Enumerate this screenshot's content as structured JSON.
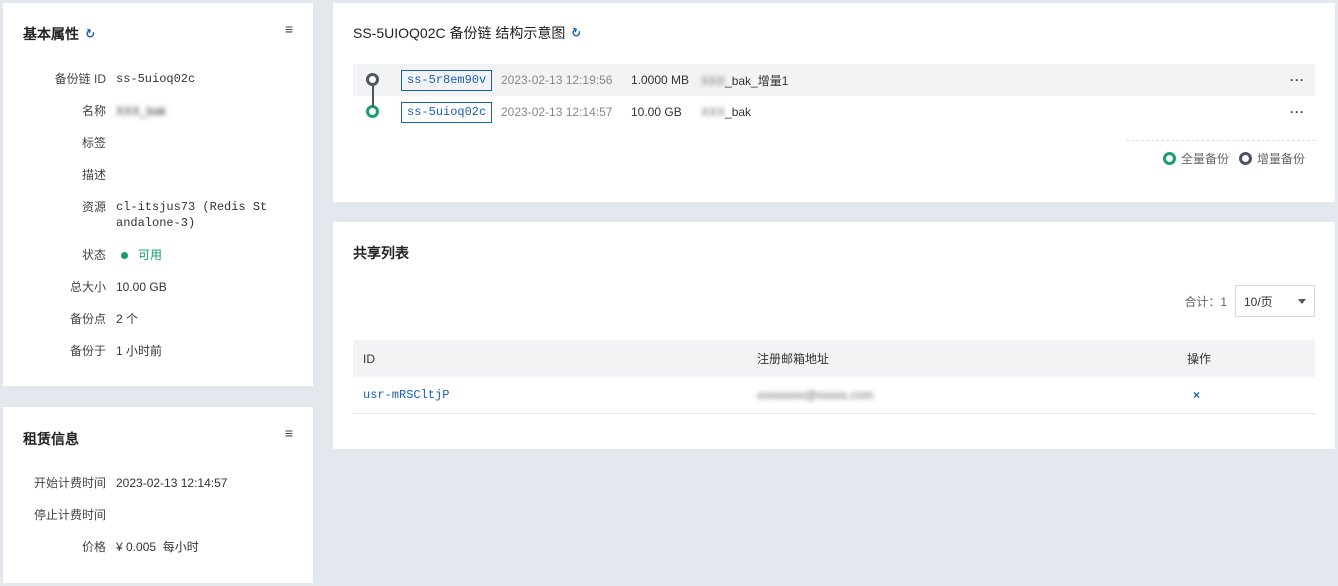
{
  "basic": {
    "title": "基本属性",
    "fields": [
      {
        "key": "备份链 ID",
        "value": "ss-5uioq02c"
      },
      {
        "key": "名称",
        "value": "XXX_bak"
      },
      {
        "key": "标签",
        "value": ""
      },
      {
        "key": "描述",
        "value": ""
      },
      {
        "key": "资源",
        "value_line1": "cl-itsjus73 (Redis St",
        "value_line2": "andalone-3)"
      },
      {
        "key": "状态",
        "value": "可用"
      },
      {
        "key": "总大小",
        "value": "10.00 GB"
      },
      {
        "key": "备份点",
        "value": "2 个"
      },
      {
        "key": "备份于",
        "value": "1 小时前"
      }
    ]
  },
  "lease": {
    "title": "租赁信息",
    "fields": [
      {
        "key": "开始计费时间",
        "value": "2023-02-13 12:14:57"
      },
      {
        "key": "停止计费时间",
        "value": ""
      },
      {
        "key": "价格",
        "value": "¥ 0.005  每小时"
      }
    ]
  },
  "chain": {
    "title": "SS-5UIOQ02C 备份链 结构示意图",
    "rows": [
      {
        "id": "ss-5r8em90v",
        "time": "2023-02-13 12:19:56",
        "size": "1.0000 MB",
        "name_prefix": "XXX",
        "name_suffix": "_bak_增量1",
        "type": "incremental"
      },
      {
        "id": "ss-5uioq02c",
        "time": "2023-02-13 12:14:57",
        "size": "10.00 GB",
        "name_prefix": "XXX",
        "name_suffix": "_bak",
        "type": "full"
      }
    ],
    "more": "···",
    "legend": {
      "full": "全量备份",
      "incremental": "增量备份"
    },
    "colors": {
      "full": "#1a9e6a",
      "incremental": "#4b5662"
    }
  },
  "share": {
    "title": "共享列表",
    "total_label": "合计：1",
    "page_size": "10/页",
    "columns": [
      "ID",
      "注册邮箱地址",
      "操作"
    ],
    "rows": [
      {
        "id": "usr-mRSCltjP",
        "email": "xxxxxxxx@xxxxx.com",
        "action": "×"
      }
    ]
  },
  "menu_icon": "≡",
  "refresh_icon": "↻"
}
